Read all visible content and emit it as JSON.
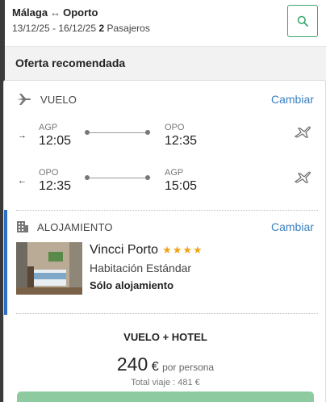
{
  "header": {
    "origin": "Málaga",
    "route_arrow": "↔",
    "destination": "Oporto",
    "dates": "13/12/25 - 16/12/25",
    "passengers_count": "2",
    "passengers_label": "Pasajeros",
    "search_icon": "search-icon"
  },
  "offer": {
    "title": "Oferta recomendada"
  },
  "flight": {
    "label": "VUELO",
    "change_label": "Cambiar",
    "legs": [
      {
        "direction": "→",
        "from_code": "AGP",
        "from_time": "12:05",
        "to_code": "OPO",
        "to_time": "12:35"
      },
      {
        "direction": "←",
        "from_code": "OPO",
        "from_time": "12:35",
        "to_code": "AGP",
        "to_time": "15:05"
      }
    ]
  },
  "lodging": {
    "label": "ALOJAMIENTO",
    "change_label": "Cambiar",
    "hotel_name": "Vincci Porto",
    "stars": "★★★★",
    "room": "Habitación Estándar",
    "board": "Sólo alojamiento"
  },
  "package": {
    "title": "VUELO + HOTEL",
    "price": "240",
    "currency": "€",
    "per_person": "por persona",
    "total": "Total viaje : 481 €"
  },
  "colors": {
    "accent_green": "#3aa76d",
    "link_blue": "#3a7fc1",
    "hotel_bar": "#2d6fc4",
    "star": "#f0a419",
    "cta": "#8ecaa0"
  }
}
